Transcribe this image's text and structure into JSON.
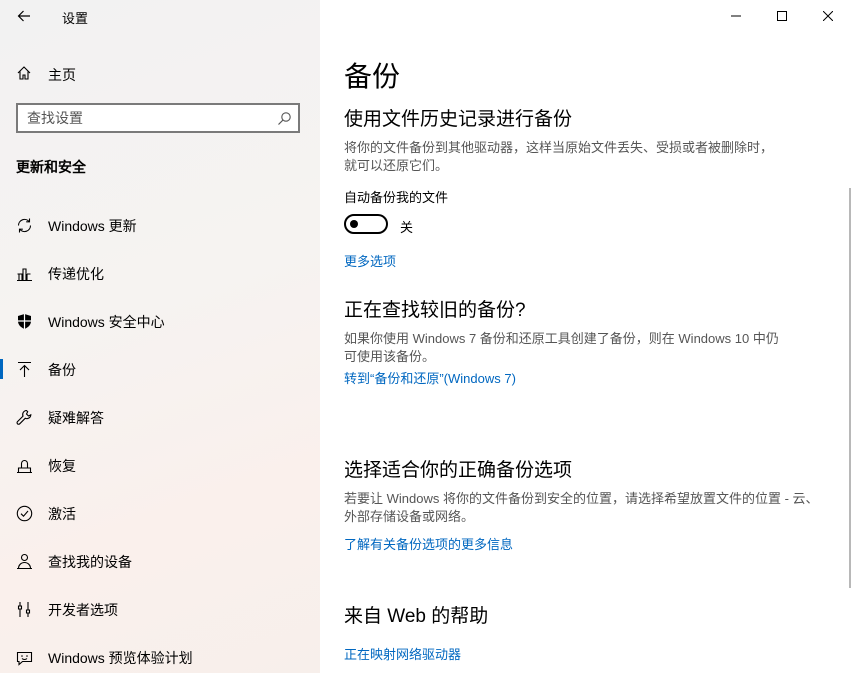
{
  "window": {
    "title": "设置",
    "back_icon": "arrow-left-icon",
    "controls": [
      "minimize-icon",
      "maximize-icon",
      "close-icon"
    ]
  },
  "sidebar": {
    "home": {
      "label": "主页",
      "icon": "home-icon"
    },
    "search": {
      "placeholder": "查找设置",
      "value": "",
      "icon": "search-icon"
    },
    "section_title": "更新和安全",
    "items": [
      {
        "label": "Windows 更新",
        "icon": "sync-icon",
        "selected": false
      },
      {
        "label": "传递优化",
        "icon": "delivery-optimization-icon",
        "selected": false
      },
      {
        "label": "Windows 安全中心",
        "icon": "shield-icon",
        "selected": false
      },
      {
        "label": "备份",
        "icon": "backup-arrow-icon",
        "selected": true
      },
      {
        "label": "疑难解答",
        "icon": "wrench-icon",
        "selected": false
      },
      {
        "label": "恢复",
        "icon": "recovery-icon",
        "selected": false
      },
      {
        "label": "激活",
        "icon": "check-circle-icon",
        "selected": false
      },
      {
        "label": "查找我的设备",
        "icon": "person-location-icon",
        "selected": false
      },
      {
        "label": "开发者选项",
        "icon": "developer-tools-icon",
        "selected": false
      },
      {
        "label": "Windows 预览体验计划",
        "icon": "smiley-icon",
        "selected": false
      }
    ]
  },
  "main": {
    "page_title": "备份",
    "file_history": {
      "heading": "使用文件历史记录进行备份",
      "description": "将你的文件备份到其他驱动器，这样当原始文件丢失、受损或者被删除时，就可以还原它们。",
      "toggle_label": "自动备份我的文件",
      "toggle_on": false,
      "toggle_state": "关",
      "more_options_link": "更多选项"
    },
    "older_backup": {
      "heading": "正在查找较旧的备份?",
      "description": "如果你使用 Windows 7 备份和还原工具创建了备份，则在 Windows 10 中仍可使用该备份。",
      "link": "转到“备份和还原”(Windows 7)"
    },
    "choose_backup": {
      "heading": "选择适合你的正确备份选项",
      "description": "若要让 Windows 将你的文件备份到安全的位置，请选择希望放置文件的位置 - 云、外部存储设备或网络。",
      "link": "了解有关备份选项的更多信息"
    },
    "web_help": {
      "heading": "来自 Web 的帮助",
      "link": "正在映射网络驱动器"
    }
  },
  "colors": {
    "accent": "#0067c0",
    "description_text": "#555555"
  }
}
